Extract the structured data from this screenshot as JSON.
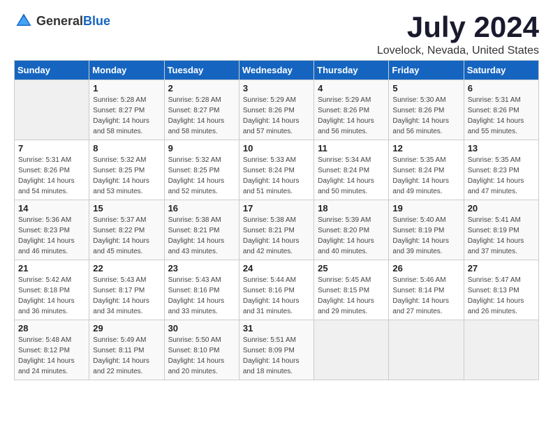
{
  "header": {
    "logo_general": "General",
    "logo_blue": "Blue",
    "title": "July 2024",
    "subtitle": "Lovelock, Nevada, United States"
  },
  "days_of_week": [
    "Sunday",
    "Monday",
    "Tuesday",
    "Wednesday",
    "Thursday",
    "Friday",
    "Saturday"
  ],
  "weeks": [
    [
      {
        "day": "",
        "info": ""
      },
      {
        "day": "1",
        "info": "Sunrise: 5:28 AM\nSunset: 8:27 PM\nDaylight: 14 hours\nand 58 minutes."
      },
      {
        "day": "2",
        "info": "Sunrise: 5:28 AM\nSunset: 8:27 PM\nDaylight: 14 hours\nand 58 minutes."
      },
      {
        "day": "3",
        "info": "Sunrise: 5:29 AM\nSunset: 8:26 PM\nDaylight: 14 hours\nand 57 minutes."
      },
      {
        "day": "4",
        "info": "Sunrise: 5:29 AM\nSunset: 8:26 PM\nDaylight: 14 hours\nand 56 minutes."
      },
      {
        "day": "5",
        "info": "Sunrise: 5:30 AM\nSunset: 8:26 PM\nDaylight: 14 hours\nand 56 minutes."
      },
      {
        "day": "6",
        "info": "Sunrise: 5:31 AM\nSunset: 8:26 PM\nDaylight: 14 hours\nand 55 minutes."
      }
    ],
    [
      {
        "day": "7",
        "info": "Sunrise: 5:31 AM\nSunset: 8:26 PM\nDaylight: 14 hours\nand 54 minutes."
      },
      {
        "day": "8",
        "info": "Sunrise: 5:32 AM\nSunset: 8:25 PM\nDaylight: 14 hours\nand 53 minutes."
      },
      {
        "day": "9",
        "info": "Sunrise: 5:32 AM\nSunset: 8:25 PM\nDaylight: 14 hours\nand 52 minutes."
      },
      {
        "day": "10",
        "info": "Sunrise: 5:33 AM\nSunset: 8:24 PM\nDaylight: 14 hours\nand 51 minutes."
      },
      {
        "day": "11",
        "info": "Sunrise: 5:34 AM\nSunset: 8:24 PM\nDaylight: 14 hours\nand 50 minutes."
      },
      {
        "day": "12",
        "info": "Sunrise: 5:35 AM\nSunset: 8:24 PM\nDaylight: 14 hours\nand 49 minutes."
      },
      {
        "day": "13",
        "info": "Sunrise: 5:35 AM\nSunset: 8:23 PM\nDaylight: 14 hours\nand 47 minutes."
      }
    ],
    [
      {
        "day": "14",
        "info": "Sunrise: 5:36 AM\nSunset: 8:23 PM\nDaylight: 14 hours\nand 46 minutes."
      },
      {
        "day": "15",
        "info": "Sunrise: 5:37 AM\nSunset: 8:22 PM\nDaylight: 14 hours\nand 45 minutes."
      },
      {
        "day": "16",
        "info": "Sunrise: 5:38 AM\nSunset: 8:21 PM\nDaylight: 14 hours\nand 43 minutes."
      },
      {
        "day": "17",
        "info": "Sunrise: 5:38 AM\nSunset: 8:21 PM\nDaylight: 14 hours\nand 42 minutes."
      },
      {
        "day": "18",
        "info": "Sunrise: 5:39 AM\nSunset: 8:20 PM\nDaylight: 14 hours\nand 40 minutes."
      },
      {
        "day": "19",
        "info": "Sunrise: 5:40 AM\nSunset: 8:19 PM\nDaylight: 14 hours\nand 39 minutes."
      },
      {
        "day": "20",
        "info": "Sunrise: 5:41 AM\nSunset: 8:19 PM\nDaylight: 14 hours\nand 37 minutes."
      }
    ],
    [
      {
        "day": "21",
        "info": "Sunrise: 5:42 AM\nSunset: 8:18 PM\nDaylight: 14 hours\nand 36 minutes."
      },
      {
        "day": "22",
        "info": "Sunrise: 5:43 AM\nSunset: 8:17 PM\nDaylight: 14 hours\nand 34 minutes."
      },
      {
        "day": "23",
        "info": "Sunrise: 5:43 AM\nSunset: 8:16 PM\nDaylight: 14 hours\nand 33 minutes."
      },
      {
        "day": "24",
        "info": "Sunrise: 5:44 AM\nSunset: 8:16 PM\nDaylight: 14 hours\nand 31 minutes."
      },
      {
        "day": "25",
        "info": "Sunrise: 5:45 AM\nSunset: 8:15 PM\nDaylight: 14 hours\nand 29 minutes."
      },
      {
        "day": "26",
        "info": "Sunrise: 5:46 AM\nSunset: 8:14 PM\nDaylight: 14 hours\nand 27 minutes."
      },
      {
        "day": "27",
        "info": "Sunrise: 5:47 AM\nSunset: 8:13 PM\nDaylight: 14 hours\nand 26 minutes."
      }
    ],
    [
      {
        "day": "28",
        "info": "Sunrise: 5:48 AM\nSunset: 8:12 PM\nDaylight: 14 hours\nand 24 minutes."
      },
      {
        "day": "29",
        "info": "Sunrise: 5:49 AM\nSunset: 8:11 PM\nDaylight: 14 hours\nand 22 minutes."
      },
      {
        "day": "30",
        "info": "Sunrise: 5:50 AM\nSunset: 8:10 PM\nDaylight: 14 hours\nand 20 minutes."
      },
      {
        "day": "31",
        "info": "Sunrise: 5:51 AM\nSunset: 8:09 PM\nDaylight: 14 hours\nand 18 minutes."
      },
      {
        "day": "",
        "info": ""
      },
      {
        "day": "",
        "info": ""
      },
      {
        "day": "",
        "info": ""
      }
    ]
  ]
}
